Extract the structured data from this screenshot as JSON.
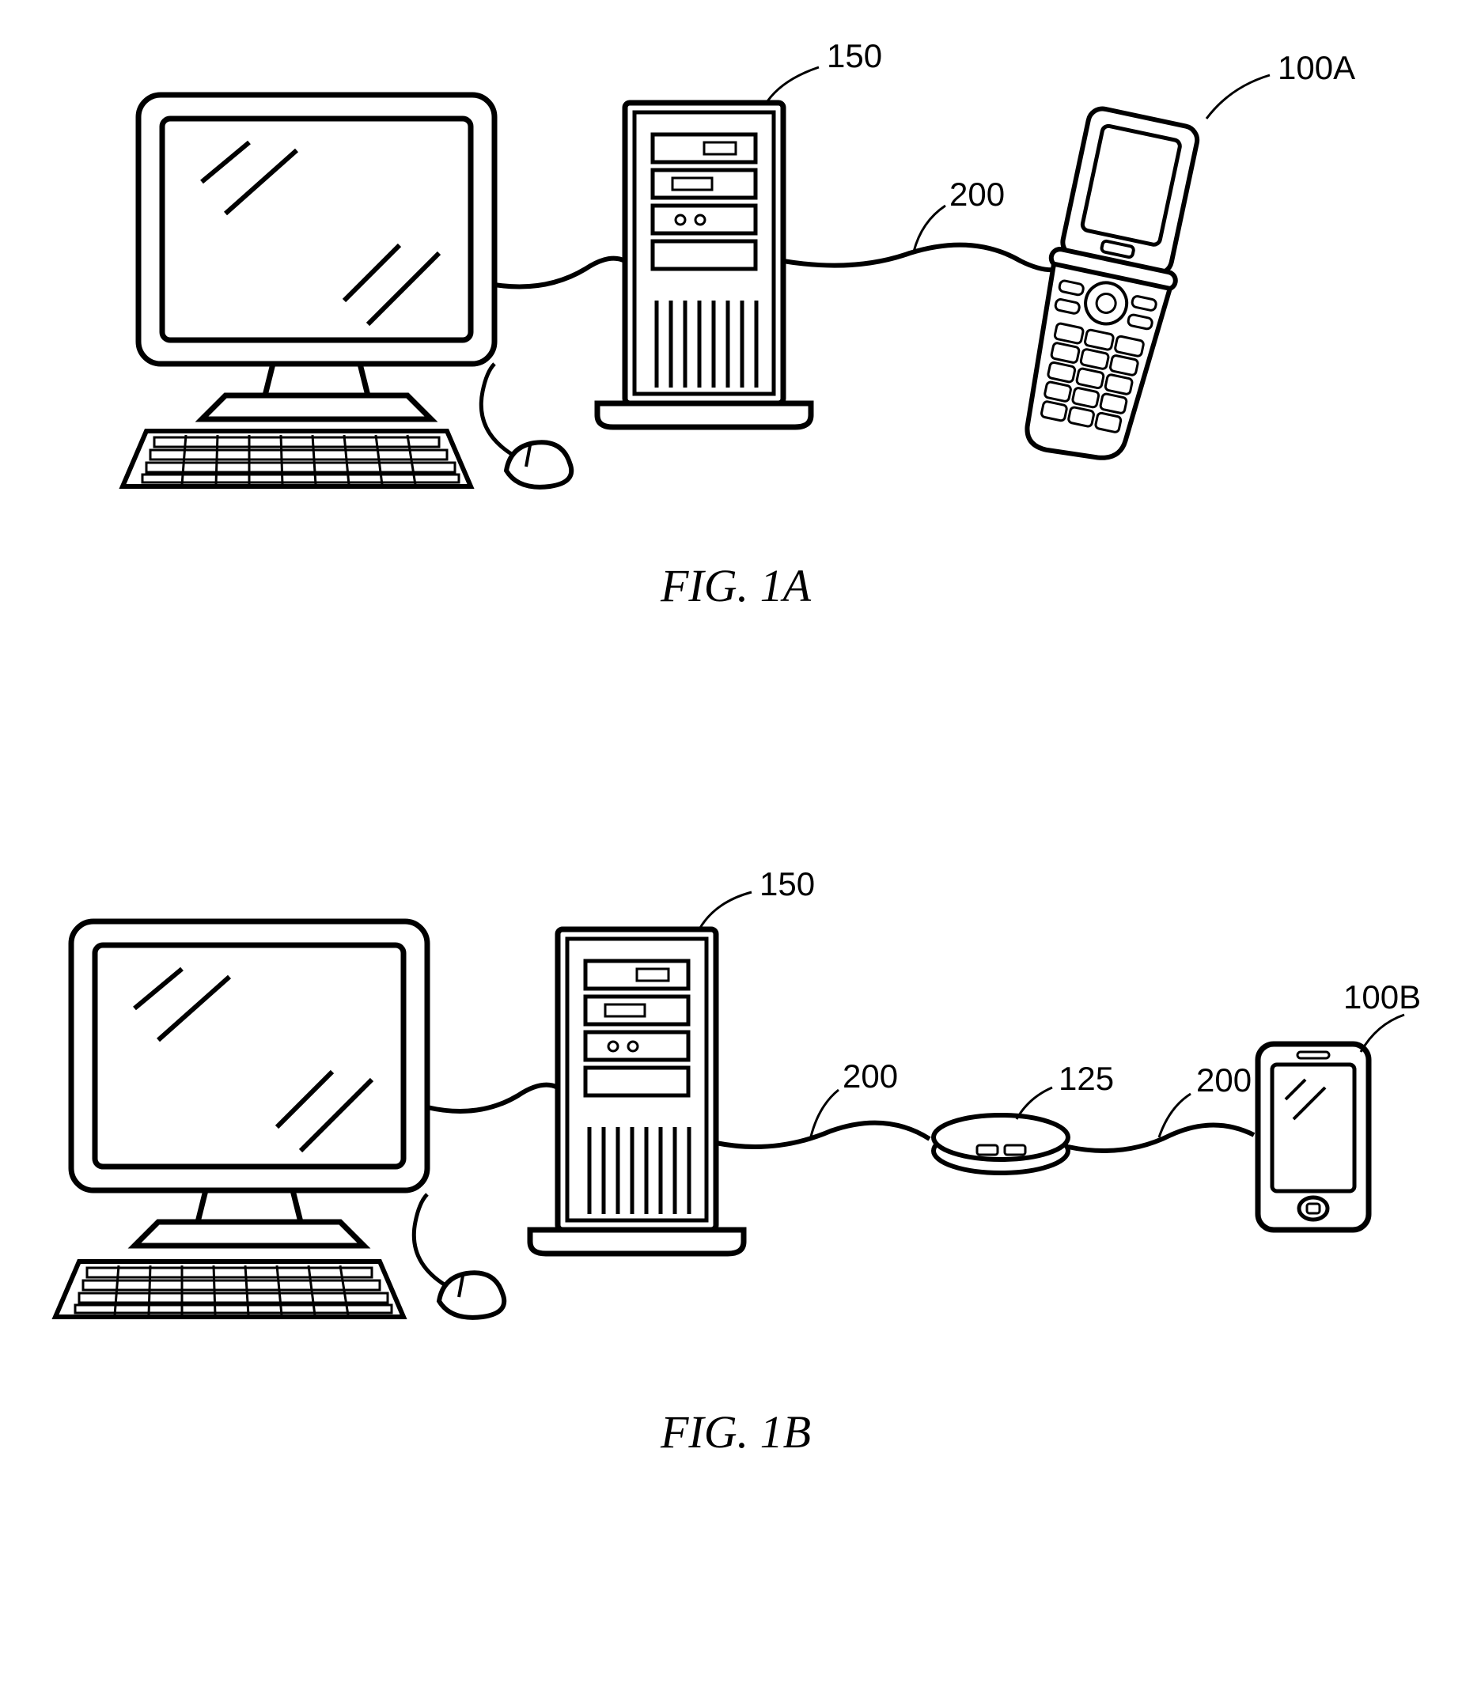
{
  "figures": {
    "a": {
      "caption": "FIG. 1A",
      "labels": {
        "tower": "150",
        "phone": "100A",
        "cable": "200"
      }
    },
    "b": {
      "caption": "FIG. 1B",
      "labels": {
        "tower": "150",
        "hub": "125",
        "phone": "100B",
        "cable1": "200",
        "cable2": "200"
      }
    }
  }
}
